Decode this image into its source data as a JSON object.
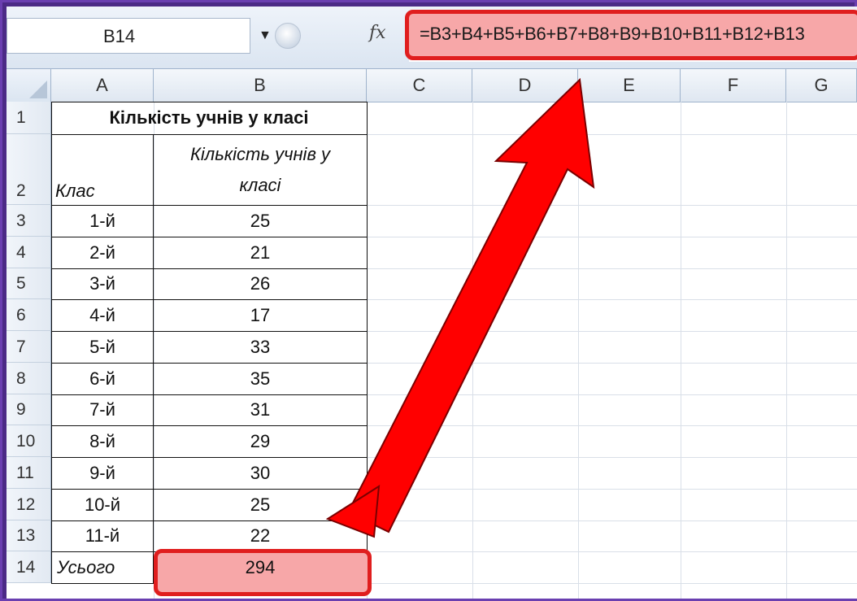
{
  "formula_bar": {
    "name_box": "B14",
    "dropdown_icon": "chevron-down-icon",
    "fx_label": "fx",
    "formula": "=B3+B4+B5+B6+B7+B8+B9+B10+B11+B12+B13"
  },
  "columns": [
    "A",
    "B",
    "C",
    "D",
    "E",
    "F",
    "G"
  ],
  "rows": [
    "1",
    "2",
    "3",
    "4",
    "5",
    "6",
    "7",
    "8",
    "9",
    "10",
    "11",
    "12",
    "13",
    "14"
  ],
  "sheet": {
    "title": "Кількість учнів у класі",
    "header_a": "Клас",
    "header_b_line1": "Кількість учнів у",
    "header_b_line2": "класі",
    "data": [
      {
        "class": "1-й",
        "count": "25"
      },
      {
        "class": "2-й",
        "count": "21"
      },
      {
        "class": "3-й",
        "count": "26"
      },
      {
        "class": "4-й",
        "count": "17"
      },
      {
        "class": "5-й",
        "count": "33"
      },
      {
        "class": "6-й",
        "count": "35"
      },
      {
        "class": "7-й",
        "count": "31"
      },
      {
        "class": "8-й",
        "count": "29"
      },
      {
        "class": "9-й",
        "count": "30"
      },
      {
        "class": "10-й",
        "count": "25"
      },
      {
        "class": "11-й",
        "count": "22"
      }
    ],
    "total_label": "Усього",
    "total_value": "294"
  },
  "colors": {
    "highlight_fill": "#f7a7a8",
    "highlight_border": "#e01e1e",
    "arrow": "#ff0000",
    "frame": "#4b2a86"
  }
}
